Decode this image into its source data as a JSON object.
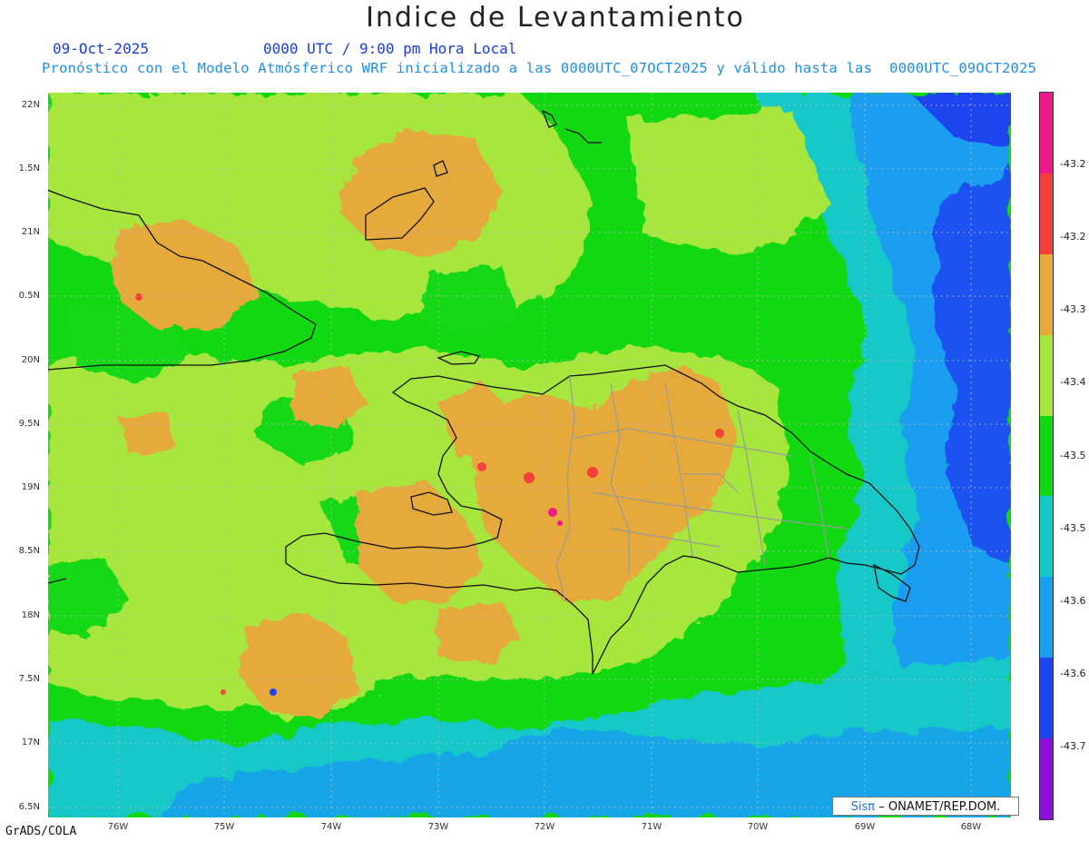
{
  "title": "Indice de Levantamiento",
  "date": "09-Oct-2025",
  "time": "0000 UTC / 9:00 pm Hora Local",
  "forecast_note": "Pronóstico con el Modelo Atmósferico WRF inicializado a las 0000UTC_07OCT2025 y válido hasta las  0000UTC_09OCT2025",
  "lat_labels": [
    "22N",
    "1.5N",
    "21N",
    "0.5N",
    "20N",
    "9.5N",
    "19N",
    "8.5N",
    "18N",
    "7.5N",
    "17N",
    "6.5N"
  ],
  "lon_labels": [
    "76W",
    "75W",
    "74W",
    "73W",
    "72W",
    "71W",
    "70W",
    "69W",
    "68W"
  ],
  "colorbar_labels": [
    "-43.2",
    "-43.2",
    "-43.3",
    "-43.4",
    "-43.5",
    "-43.5",
    "-43.6",
    "-43.6",
    "-43.7"
  ],
  "colorbar_colors": [
    "#ee1a8c",
    "#f2403c",
    "#e6a93a",
    "#a7e63c",
    "#12d812",
    "#15c8c8",
    "#1a9ef0",
    "#1f45f0",
    "#8a12d8"
  ],
  "field_colors": {
    "orange": "#e6a93a",
    "light_green": "#a7e63c",
    "green": "#12d812",
    "cyan": "#15c8c8",
    "light_blue": "#1a9ef0",
    "blue": "#1f45f0",
    "purple": "#8a12d8",
    "red": "#f2403c",
    "magenta": "#ee1a8c"
  },
  "credit": {
    "logo": "Sisπ",
    "text": "– ONAMET/REP.DOM."
  },
  "footer": "GrADS/COLA"
}
